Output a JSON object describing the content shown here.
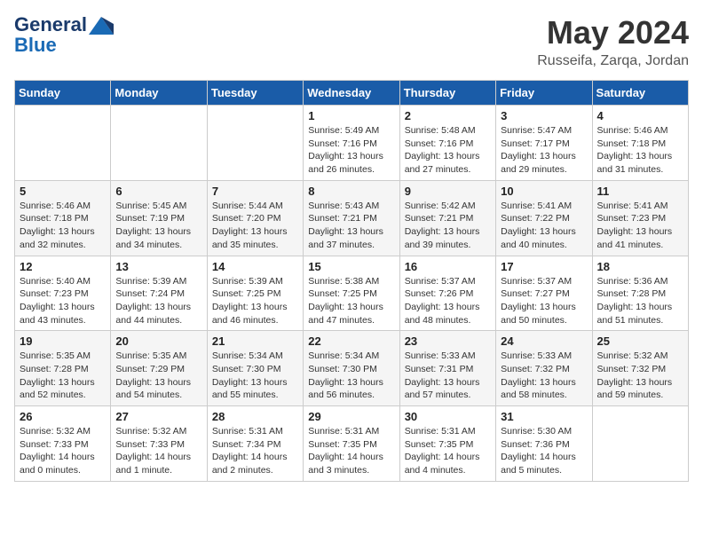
{
  "header": {
    "logo_line1": "General",
    "logo_line2": "Blue",
    "month": "May 2024",
    "location": "Russeifa, Zarqa, Jordan"
  },
  "weekdays": [
    "Sunday",
    "Monday",
    "Tuesday",
    "Wednesday",
    "Thursday",
    "Friday",
    "Saturday"
  ],
  "weeks": [
    [
      {
        "day": "",
        "info": ""
      },
      {
        "day": "",
        "info": ""
      },
      {
        "day": "",
        "info": ""
      },
      {
        "day": "1",
        "info": "Sunrise: 5:49 AM\nSunset: 7:16 PM\nDaylight: 13 hours and 26 minutes."
      },
      {
        "day": "2",
        "info": "Sunrise: 5:48 AM\nSunset: 7:16 PM\nDaylight: 13 hours and 27 minutes."
      },
      {
        "day": "3",
        "info": "Sunrise: 5:47 AM\nSunset: 7:17 PM\nDaylight: 13 hours and 29 minutes."
      },
      {
        "day": "4",
        "info": "Sunrise: 5:46 AM\nSunset: 7:18 PM\nDaylight: 13 hours and 31 minutes."
      }
    ],
    [
      {
        "day": "5",
        "info": "Sunrise: 5:46 AM\nSunset: 7:18 PM\nDaylight: 13 hours and 32 minutes."
      },
      {
        "day": "6",
        "info": "Sunrise: 5:45 AM\nSunset: 7:19 PM\nDaylight: 13 hours and 34 minutes."
      },
      {
        "day": "7",
        "info": "Sunrise: 5:44 AM\nSunset: 7:20 PM\nDaylight: 13 hours and 35 minutes."
      },
      {
        "day": "8",
        "info": "Sunrise: 5:43 AM\nSunset: 7:21 PM\nDaylight: 13 hours and 37 minutes."
      },
      {
        "day": "9",
        "info": "Sunrise: 5:42 AM\nSunset: 7:21 PM\nDaylight: 13 hours and 39 minutes."
      },
      {
        "day": "10",
        "info": "Sunrise: 5:41 AM\nSunset: 7:22 PM\nDaylight: 13 hours and 40 minutes."
      },
      {
        "day": "11",
        "info": "Sunrise: 5:41 AM\nSunset: 7:23 PM\nDaylight: 13 hours and 41 minutes."
      }
    ],
    [
      {
        "day": "12",
        "info": "Sunrise: 5:40 AM\nSunset: 7:23 PM\nDaylight: 13 hours and 43 minutes."
      },
      {
        "day": "13",
        "info": "Sunrise: 5:39 AM\nSunset: 7:24 PM\nDaylight: 13 hours and 44 minutes."
      },
      {
        "day": "14",
        "info": "Sunrise: 5:39 AM\nSunset: 7:25 PM\nDaylight: 13 hours and 46 minutes."
      },
      {
        "day": "15",
        "info": "Sunrise: 5:38 AM\nSunset: 7:25 PM\nDaylight: 13 hours and 47 minutes."
      },
      {
        "day": "16",
        "info": "Sunrise: 5:37 AM\nSunset: 7:26 PM\nDaylight: 13 hours and 48 minutes."
      },
      {
        "day": "17",
        "info": "Sunrise: 5:37 AM\nSunset: 7:27 PM\nDaylight: 13 hours and 50 minutes."
      },
      {
        "day": "18",
        "info": "Sunrise: 5:36 AM\nSunset: 7:28 PM\nDaylight: 13 hours and 51 minutes."
      }
    ],
    [
      {
        "day": "19",
        "info": "Sunrise: 5:35 AM\nSunset: 7:28 PM\nDaylight: 13 hours and 52 minutes."
      },
      {
        "day": "20",
        "info": "Sunrise: 5:35 AM\nSunset: 7:29 PM\nDaylight: 13 hours and 54 minutes."
      },
      {
        "day": "21",
        "info": "Sunrise: 5:34 AM\nSunset: 7:30 PM\nDaylight: 13 hours and 55 minutes."
      },
      {
        "day": "22",
        "info": "Sunrise: 5:34 AM\nSunset: 7:30 PM\nDaylight: 13 hours and 56 minutes."
      },
      {
        "day": "23",
        "info": "Sunrise: 5:33 AM\nSunset: 7:31 PM\nDaylight: 13 hours and 57 minutes."
      },
      {
        "day": "24",
        "info": "Sunrise: 5:33 AM\nSunset: 7:32 PM\nDaylight: 13 hours and 58 minutes."
      },
      {
        "day": "25",
        "info": "Sunrise: 5:32 AM\nSunset: 7:32 PM\nDaylight: 13 hours and 59 minutes."
      }
    ],
    [
      {
        "day": "26",
        "info": "Sunrise: 5:32 AM\nSunset: 7:33 PM\nDaylight: 14 hours and 0 minutes."
      },
      {
        "day": "27",
        "info": "Sunrise: 5:32 AM\nSunset: 7:33 PM\nDaylight: 14 hours and 1 minute."
      },
      {
        "day": "28",
        "info": "Sunrise: 5:31 AM\nSunset: 7:34 PM\nDaylight: 14 hours and 2 minutes."
      },
      {
        "day": "29",
        "info": "Sunrise: 5:31 AM\nSunset: 7:35 PM\nDaylight: 14 hours and 3 minutes."
      },
      {
        "day": "30",
        "info": "Sunrise: 5:31 AM\nSunset: 7:35 PM\nDaylight: 14 hours and 4 minutes."
      },
      {
        "day": "31",
        "info": "Sunrise: 5:30 AM\nSunset: 7:36 PM\nDaylight: 14 hours and 5 minutes."
      },
      {
        "day": "",
        "info": ""
      }
    ]
  ]
}
